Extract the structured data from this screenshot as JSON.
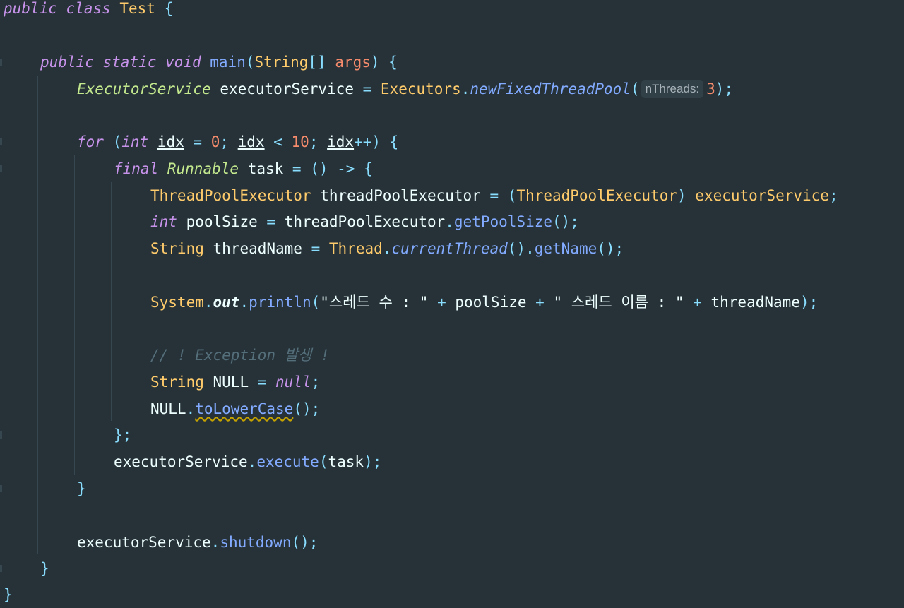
{
  "code": {
    "l1": {
      "kw_public": "public",
      "kw_class": "class",
      "class_name": "Test",
      "brace": " {"
    },
    "l3": {
      "kw_public": "public",
      "kw_static": "static",
      "kw_void": "void",
      "method": "main",
      "open": "(",
      "param_type": "String",
      "arr": "[]",
      "param": "args",
      "close": ") {"
    },
    "l4": {
      "type": "ExecutorService",
      "var": "executorService",
      "eq": " = ",
      "cls": "Executors",
      "dot": ".",
      "method": "newFixedThreadPool",
      "open": "(",
      "hint": "nThreads:",
      "num": "3",
      "close": ");"
    },
    "l6": {
      "kw_for": "for",
      "open": " (",
      "kw_int": "int",
      "idx1": "idx",
      "eq": " = ",
      "zero": "0",
      "semi1": "; ",
      "idx2": "idx",
      "lt": " < ",
      "ten": "10",
      "semi2": "; ",
      "idx3": "idx",
      "inc": "++",
      "close": ") {"
    },
    "l7": {
      "kw_final": "final",
      "type": "Runnable",
      "var": "task",
      "eq": " = ",
      "lambda": "() -> {"
    },
    "l8": {
      "type1": "ThreadPoolExecutor",
      "var": "threadPoolExecutor",
      "eq": " = ",
      "cast_open": "(",
      "type2": "ThreadPoolExecutor",
      "cast_close": ") ",
      "src": "executorService",
      "semi": ";"
    },
    "l9": {
      "kw_int": "int",
      "var": "poolSize",
      "eq": " = ",
      "obj": "threadPoolExecutor",
      "dot": ".",
      "method": "getPoolSize",
      "call": "();"
    },
    "l10": {
      "type": "String",
      "var": "threadName",
      "eq": " = ",
      "cls": "Thread",
      "dot1": ".",
      "method1": "currentThread",
      "call1": "()",
      "dot2": ".",
      "method2": "getName",
      "call2": "();"
    },
    "l12": {
      "cls": "System",
      "dot1": ".",
      "field": "out",
      "dot2": ".",
      "method": "println",
      "open": "(",
      "str1": "\"스레드 수 : \"",
      "plus1": " + ",
      "var1": "poolSize",
      "plus2": " + ",
      "str2": "\" 스레드 이름 : \"",
      "plus3": " + ",
      "var2": "threadName",
      "close": ");"
    },
    "l14": {
      "comment": "// ! Exception 발생 !"
    },
    "l15": {
      "type": "String",
      "var": "NULL",
      "eq": " = ",
      "kw_null": "null",
      "semi": ";"
    },
    "l16": {
      "obj": "NULL",
      "dot": ".",
      "method": "toLowerCase",
      "call": "();"
    },
    "l17": {
      "close": "};"
    },
    "l18": {
      "obj": "executorService",
      "dot": ".",
      "method": "execute",
      "open": "(",
      "arg": "task",
      "close": ");"
    },
    "l19": {
      "close": "}"
    },
    "l21": {
      "obj": "executorService",
      "dot": ".",
      "method": "shutdown",
      "call": "();"
    },
    "l22": {
      "close": "}"
    },
    "l23": {
      "close": "}"
    }
  },
  "colors": {
    "background": "#263238",
    "keyword": "#c792ea",
    "type": "#ffcb6b",
    "function": "#82aaff",
    "number": "#f78c6c",
    "string": "#c3e88d",
    "operator": "#89ddff",
    "comment": "#546e7a",
    "text": "#eeffff"
  }
}
